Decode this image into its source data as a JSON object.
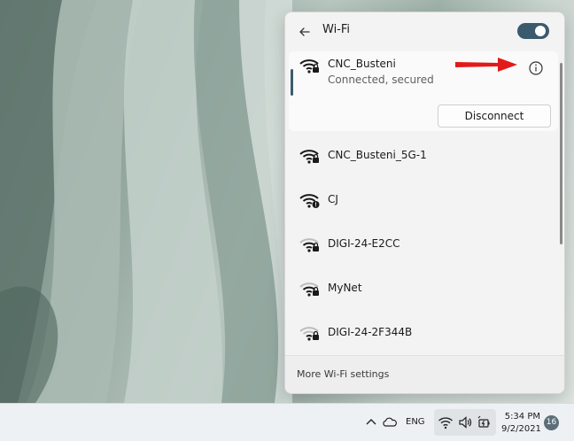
{
  "flyout": {
    "title": "Wi-Fi",
    "wifi_toggle_on": true,
    "networks": [
      {
        "name": "CNC_Busteni",
        "status": "Connected, secured",
        "action": "Disconnect"
      },
      {
        "name": "CNC_Busteni_5G-1"
      },
      {
        "name": "CJ"
      },
      {
        "name": "DIGI-24-E2CC"
      },
      {
        "name": "MyNet"
      },
      {
        "name": "DIGI-24-2F344B"
      }
    ],
    "footer_link": "More Wi-Fi settings"
  },
  "taskbar": {
    "language": "ENG",
    "time": "5:34 PM",
    "date": "9/2/2021",
    "notification_count": "16"
  },
  "colors": {
    "accent": "#3c5a6e",
    "arrow": "#e31a1a"
  }
}
